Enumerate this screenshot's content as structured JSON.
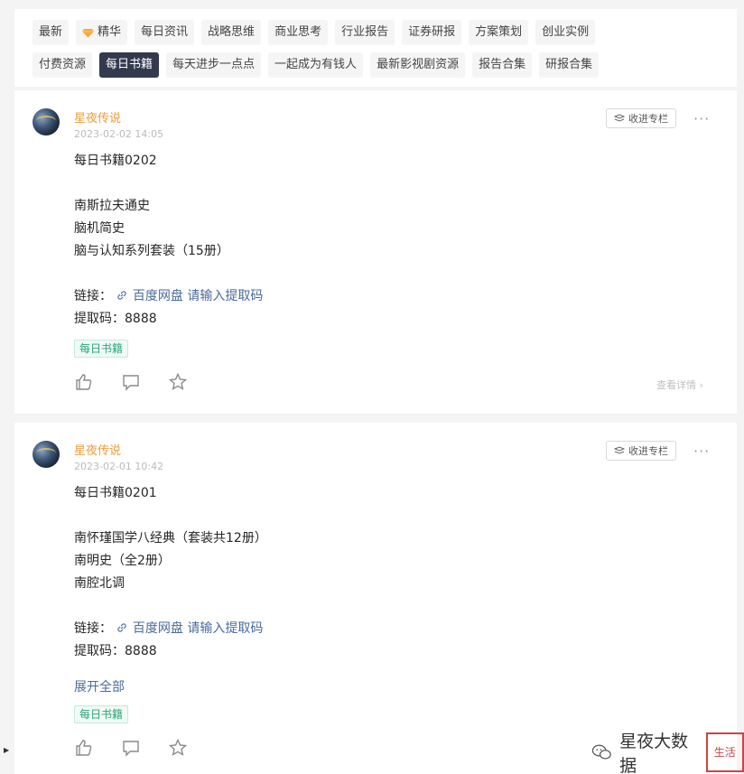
{
  "tags_row1": [
    {
      "label": "最新",
      "active": false
    },
    {
      "label": "精华",
      "active": false,
      "icon": "diamond-icon"
    },
    {
      "label": "每日资讯",
      "active": false
    },
    {
      "label": "战略思维",
      "active": false
    },
    {
      "label": "商业思考",
      "active": false
    },
    {
      "label": "行业报告",
      "active": false
    },
    {
      "label": "证券研报",
      "active": false
    },
    {
      "label": "方案策划",
      "active": false
    },
    {
      "label": "创业实例",
      "active": false
    }
  ],
  "tags_row2": [
    {
      "label": "付费资源",
      "active": false
    },
    {
      "label": "每日书籍",
      "active": true
    },
    {
      "label": "每天进步一点点",
      "active": false
    },
    {
      "label": "一起成为有钱人",
      "active": false
    },
    {
      "label": "最新影视剧资源",
      "active": false
    },
    {
      "label": "报告合集",
      "active": false
    },
    {
      "label": "研报合集",
      "active": false
    }
  ],
  "posts": [
    {
      "author": "星夜传说",
      "date": "2023-02-02 14:05",
      "collect_label": "收进专栏",
      "more": "···",
      "title": "每日书籍0202",
      "books": [
        "南斯拉夫通史",
        "脑机简史",
        "脑与认知系列套装（15册）"
      ],
      "link_prefix": "链接：",
      "link_text": "百度网盘 请输入提取码",
      "code": "提取码：8888",
      "topic": "每日书籍",
      "detail": "查看详情"
    },
    {
      "author": "星夜传说",
      "date": "2023-02-01 10:42",
      "collect_label": "收进专栏",
      "more": "···",
      "title": "每日书籍0201",
      "books": [
        "南怀瑾国学八经典（套装共12册）",
        "南明史（全2册）",
        "南腔北调"
      ],
      "link_prefix": "链接：",
      "link_text": "百度网盘 请输入提取码",
      "code": "提取码：8888",
      "expand": "展开全部",
      "topic": "每日书籍"
    }
  ],
  "watermark": {
    "text": "星夜大数据",
    "logo": "生活"
  },
  "colors": {
    "accent": "#333a4e",
    "author": "#ed9c3a",
    "link": "#4a6b9a",
    "topic": "#2aa478"
  }
}
